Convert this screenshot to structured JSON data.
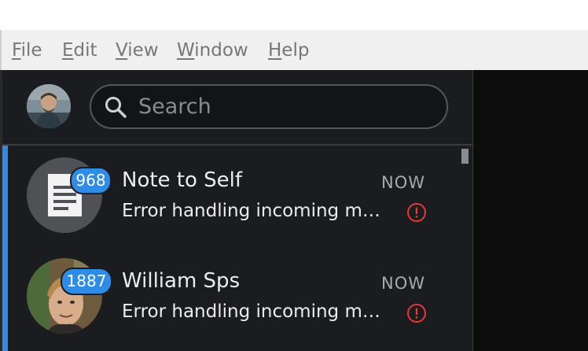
{
  "menubar": {
    "items": [
      {
        "first": "F",
        "rest": "ile"
      },
      {
        "first": "E",
        "rest": "dit"
      },
      {
        "first": "V",
        "rest": "iew"
      },
      {
        "first": "W",
        "rest": "indow"
      },
      {
        "first": "H",
        "rest": "elp"
      }
    ]
  },
  "search": {
    "placeholder": "Search",
    "value": ""
  },
  "conversations": [
    {
      "name": "Note to Self",
      "time": "NOW",
      "preview": "Error handling incoming message",
      "unread_count": "968",
      "avatar_icon": "note-icon",
      "status_icon": "error-icon"
    },
    {
      "name": "William Sps",
      "time": "NOW",
      "preview": "Error handling incoming message",
      "unread_count": "1887",
      "avatar_icon": "photo",
      "status_icon": "error-icon"
    }
  ],
  "colors": {
    "accent": "#2e8be6",
    "error": "#e53935",
    "background": "#1b1c1f"
  }
}
